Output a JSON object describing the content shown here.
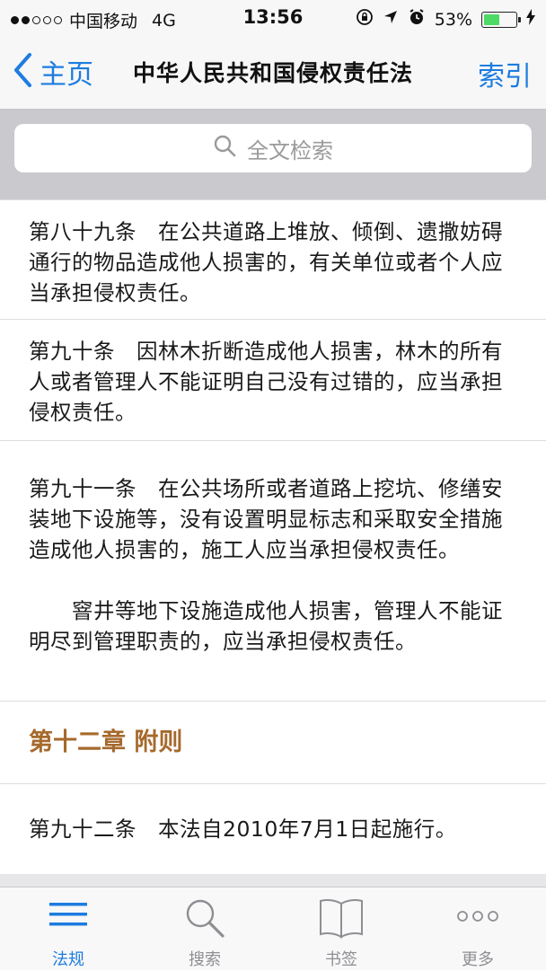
{
  "status_bar": {
    "carrier": "中国移动",
    "network": "4G",
    "time": "13:56",
    "battery_percent": "53%",
    "battery_level": 0.53,
    "signal_bars_filled": 2,
    "signal_bars_total": 5
  },
  "nav": {
    "back_label": "主页",
    "title": "中华人民共和国侵权责任法",
    "right_label": "索引"
  },
  "search": {
    "placeholder": "全文检索"
  },
  "articles": [
    {
      "paragraphs": [
        "第八十九条　在公共道路上堆放、倾倒、遗撒妨碍通行的物品造成他人损害的，有关单位或者个人应当承担侵权责任。"
      ]
    },
    {
      "paragraphs": [
        "第九十条　因林木折断造成他人损害，林木的所有人或者管理人不能证明自己没有过错的，应当承担侵权责任。"
      ]
    },
    {
      "paragraphs": [
        "第九十一条　在公共场所或者道路上挖坑、修缮安装地下设施等，没有设置明显标志和采取安全措施造成他人损害的，施工人应当承担侵权责任。",
        "　　窨井等地下设施造成他人损害，管理人不能证明尽到管理职责的，应当承担侵权责任。"
      ]
    }
  ],
  "chapter": {
    "title": "第十二章 附则"
  },
  "final_article": {
    "text": "第九十二条　本法自2010年7月1日起施行。"
  },
  "tabs": [
    {
      "label": "法规",
      "icon": "list-icon",
      "active": true
    },
    {
      "label": "搜索",
      "icon": "search-icon",
      "active": false
    },
    {
      "label": "书签",
      "icon": "book-icon",
      "active": false
    },
    {
      "label": "更多",
      "icon": "more-icon",
      "active": false
    }
  ],
  "colors": {
    "accent": "#1d7ce0",
    "chapter": "#a56a2c",
    "battery": "#4cd964"
  }
}
